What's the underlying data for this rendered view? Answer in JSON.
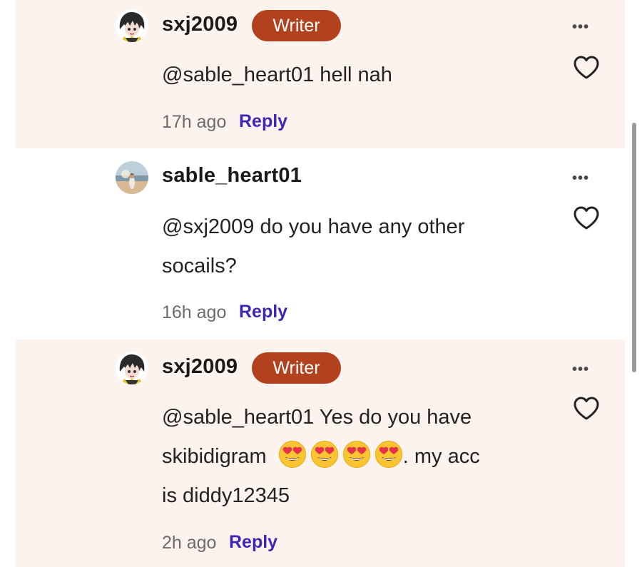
{
  "comments": [
    {
      "username": "sxj2009",
      "badge": "Writer",
      "text": "@sable_heart01 hell nah",
      "time": "17h ago",
      "reply_label": "Reply",
      "avatar_icon": "anime-avatar-icon"
    },
    {
      "username": "sable_heart01",
      "text_line1": "@sxj2009 do you have any other",
      "text_line2": "socails?",
      "time": "16h ago",
      "reply_label": "Reply",
      "avatar_icon": "beach-photo-avatar-icon"
    },
    {
      "username": "sxj2009",
      "badge": "Writer",
      "text_line1": "@sable_heart01 Yes do you have",
      "text_line2_start": "skibidigram",
      "emojis": [
        "heart-eyes-emoji",
        "heart-eyes-emoji",
        "heart-eyes-emoji",
        "heart-eyes-emoji"
      ],
      "text_line2_end": ". my acc",
      "text_line3": "is diddy12345",
      "time": "2h ago",
      "reply_label": "Reply",
      "avatar_icon": "anime-avatar-icon"
    }
  ],
  "icons": {
    "more": "more-dots-icon",
    "like": "heart-outline-icon"
  },
  "colors": {
    "writer_badge": "#b2421d",
    "reply_link": "#3f26b3",
    "highlight_bg": "#fdf3ee"
  }
}
